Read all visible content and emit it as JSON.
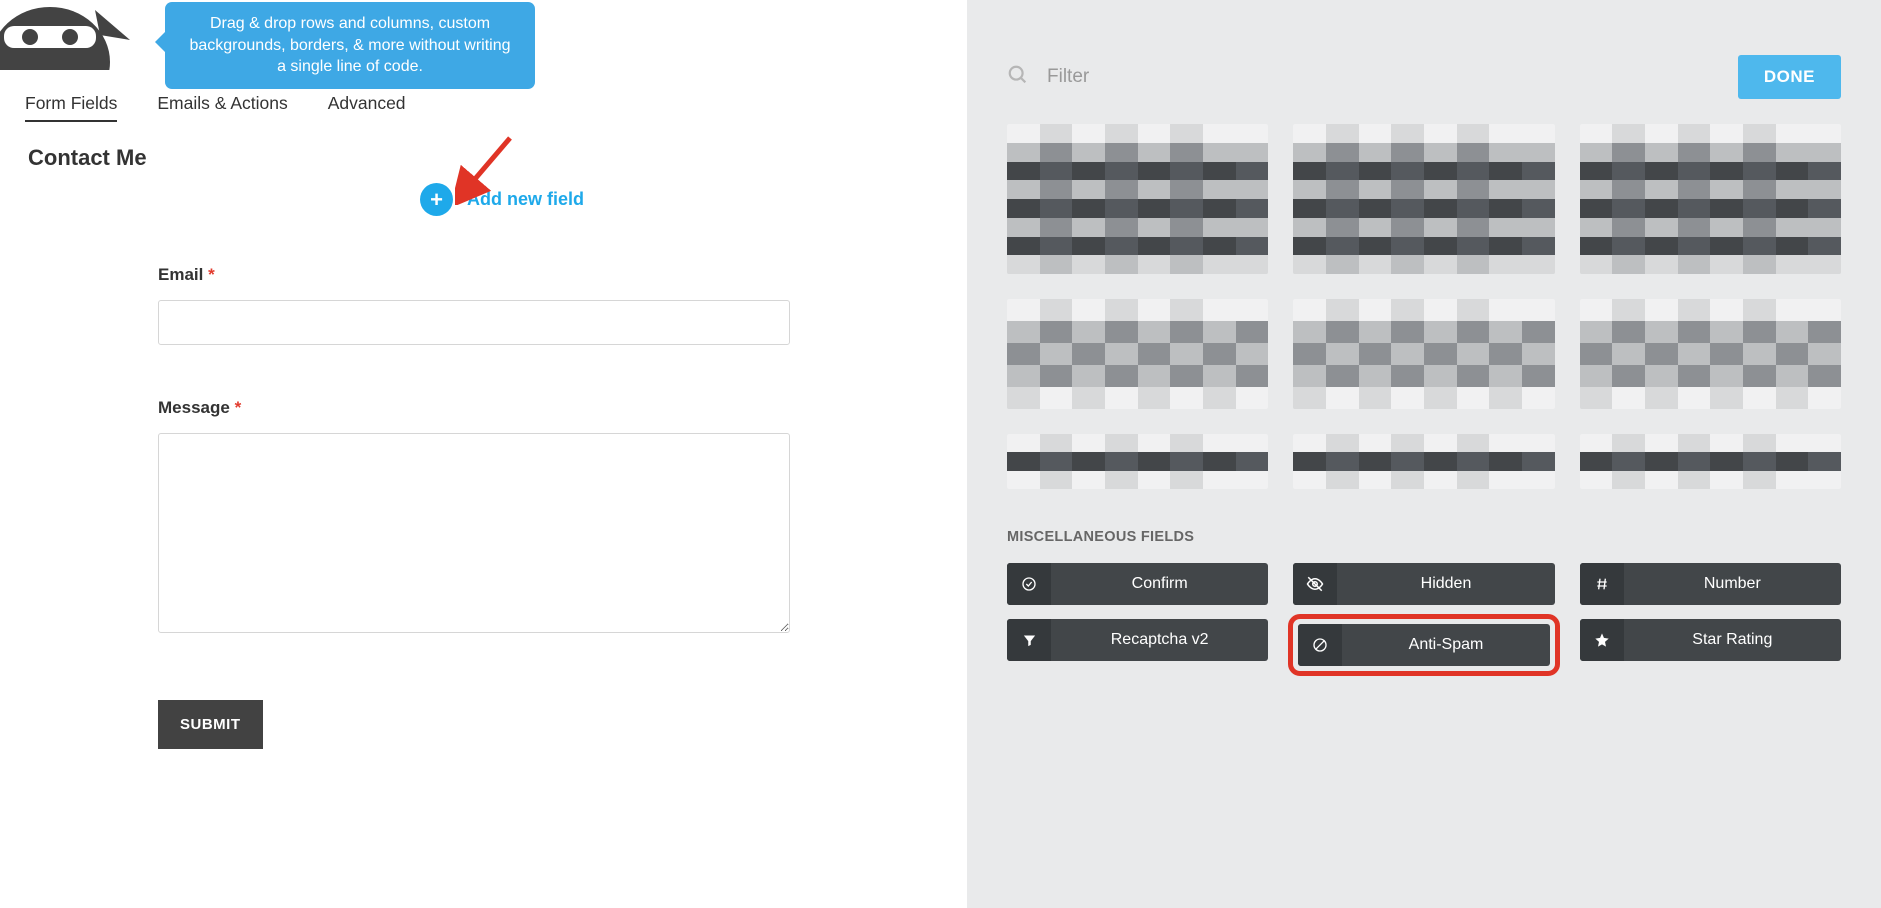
{
  "tooltip": {
    "text": "Drag & drop rows and columns, custom backgrounds, borders, & more without writing a single line of code."
  },
  "tabs": {
    "form_fields": "Form Fields",
    "emails_actions": "Emails & Actions",
    "advanced": "Advanced"
  },
  "form": {
    "title": "Contact Me",
    "add_new": "Add new field",
    "email_label": "Email",
    "message_label": "Message",
    "submit": "SUBMIT"
  },
  "right": {
    "filter_placeholder": "Filter",
    "done": "DONE",
    "section_misc": "MISCELLANEOUS FIELDS",
    "chips": {
      "confirm": "Confirm",
      "hidden": "Hidden",
      "number": "Number",
      "recaptcha": "Recaptcha v2",
      "anti_spam": "Anti-Spam",
      "star_rating": "Star Rating"
    }
  }
}
